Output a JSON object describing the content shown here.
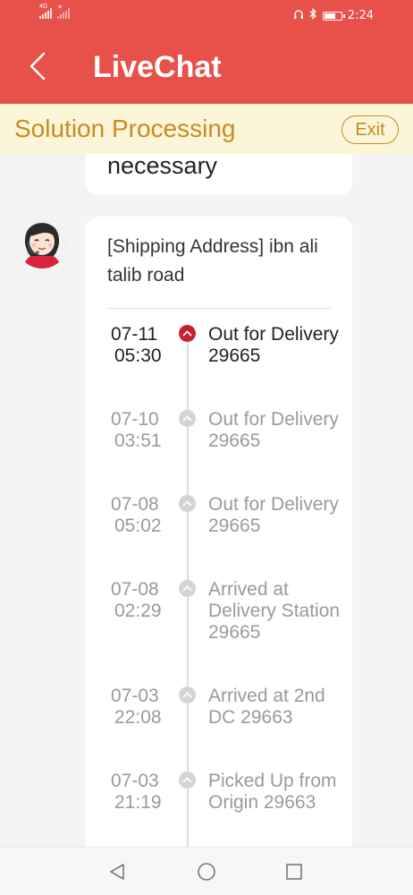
{
  "status_bar": {
    "sim1_tag": "4G",
    "sim2_tag": "✕",
    "time": "2:24",
    "battery_fraction": 0.6
  },
  "header": {
    "title": "LiveChat",
    "back_icon": "chevron-left-icon"
  },
  "banner": {
    "text": "Solution Processing",
    "exit_label": "Exit"
  },
  "chat": {
    "previous_message_tail": "necessary",
    "message": {
      "address": "[Shipping Address] ibn ali talib road",
      "timeline": [
        {
          "date": "07-11",
          "time": "05:30",
          "status": "Out for Delivery 29665",
          "active": true
        },
        {
          "date": "07-10",
          "time": "03:51",
          "status": "Out for Delivery 29665",
          "active": false
        },
        {
          "date": "07-08",
          "time": "05:02",
          "status": "Out for Delivery 29665",
          "active": false
        },
        {
          "date": "07-08",
          "time": "02:29",
          "status": "Arrived at Delivery Station 29665",
          "active": false
        },
        {
          "date": "07-03",
          "time": "22:08",
          "status": "Arrived at 2nd DC 29663",
          "active": false
        },
        {
          "date": "07-03",
          "time": "21:19",
          "status": "Picked Up from Origin 29663",
          "active": false
        }
      ]
    }
  },
  "colors": {
    "header_bg": "#e8504a",
    "banner_bg": "#fdf5d8",
    "banner_text": "#c48d22",
    "active_dot": "#c8202f"
  }
}
